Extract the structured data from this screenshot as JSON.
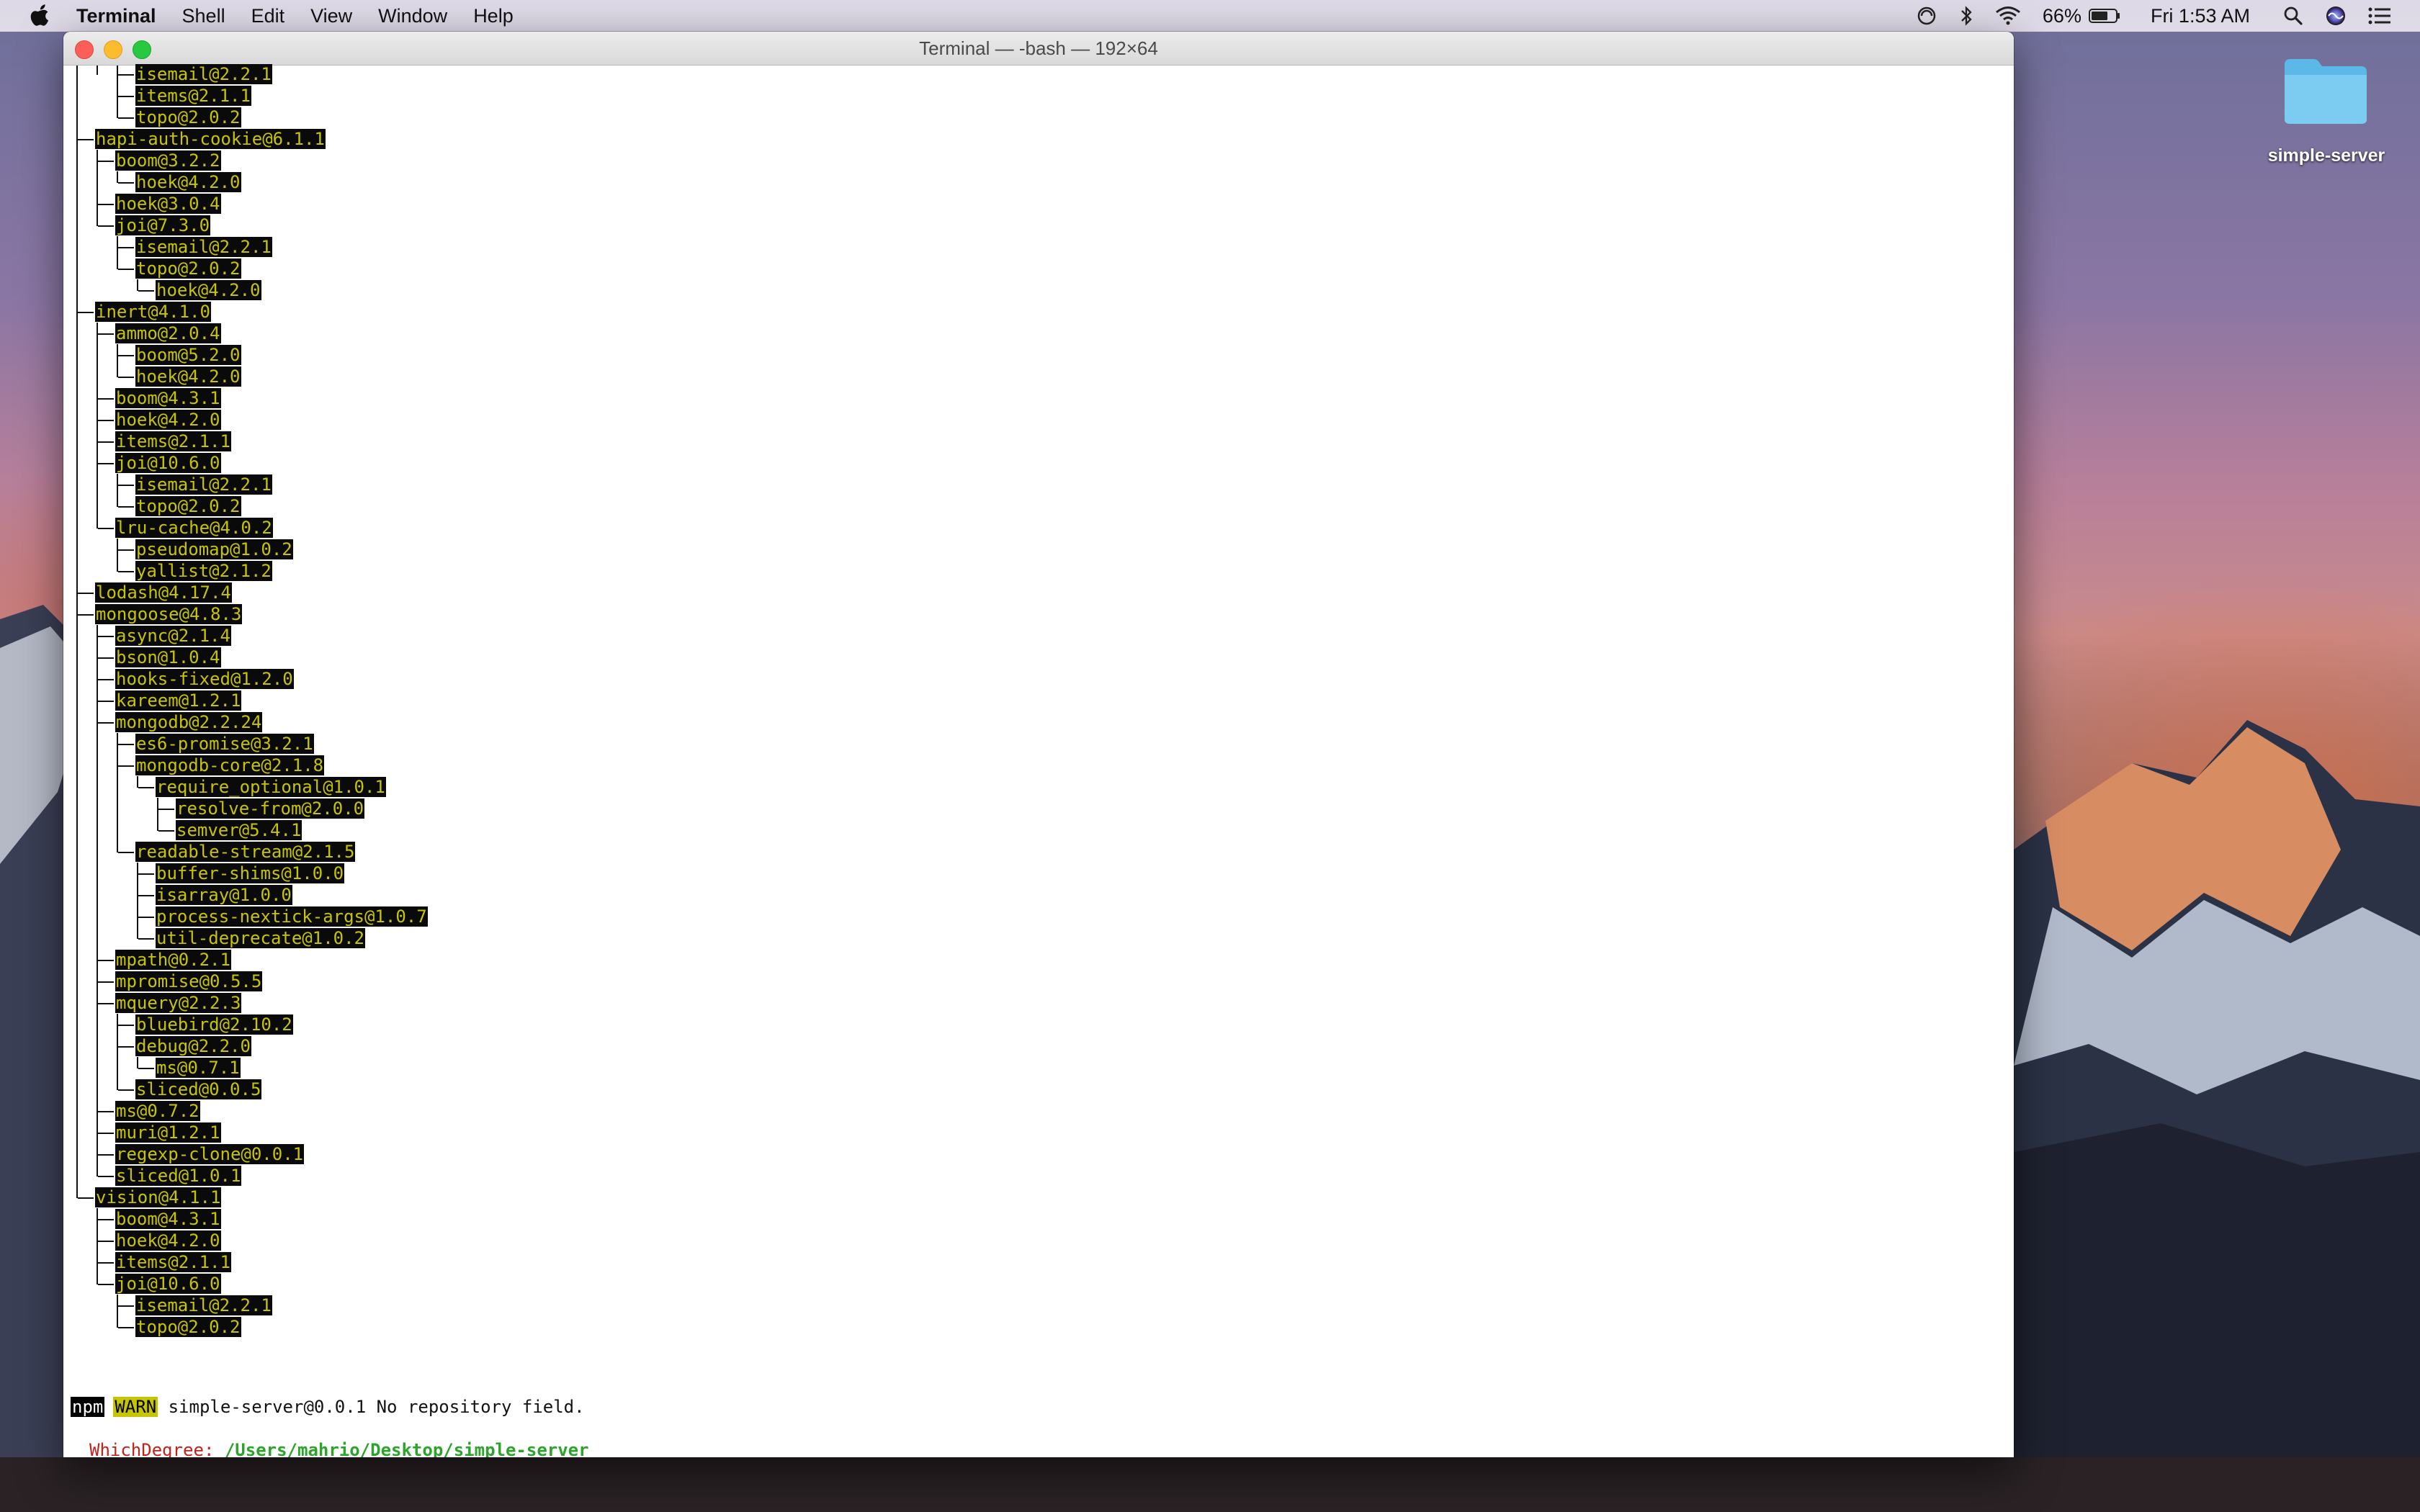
{
  "menubar": {
    "app_name": "Terminal",
    "menus": [
      "Shell",
      "Edit",
      "View",
      "Window",
      "Help"
    ],
    "battery": "66%",
    "clock": "Fri 1:53 AM"
  },
  "desktop": {
    "folder_label": "simple-server"
  },
  "window": {
    "title": "Terminal — -bash — 192×64"
  },
  "terminal": {
    "tree_lines": [
      {
        "depth": 3,
        "text": "isemail@2.2.1"
      },
      {
        "depth": 3,
        "text": "items@2.1.1"
      },
      {
        "depth": 3,
        "text": "topo@2.0.2"
      },
      {
        "depth": 1,
        "text": "hapi-auth-cookie@6.1.1"
      },
      {
        "depth": 2,
        "text": "boom@3.2.2"
      },
      {
        "depth": 3,
        "text": "hoek@4.2.0"
      },
      {
        "depth": 2,
        "text": "hoek@3.0.4"
      },
      {
        "depth": 2,
        "text": "joi@7.3.0"
      },
      {
        "depth": 3,
        "text": "isemail@2.2.1"
      },
      {
        "depth": 3,
        "text": "topo@2.0.2"
      },
      {
        "depth": 4,
        "text": "hoek@4.2.0"
      },
      {
        "depth": 1,
        "text": "inert@4.1.0"
      },
      {
        "depth": 2,
        "text": "ammo@2.0.4"
      },
      {
        "depth": 3,
        "text": "boom@5.2.0"
      },
      {
        "depth": 3,
        "text": "hoek@4.2.0"
      },
      {
        "depth": 2,
        "text": "boom@4.3.1"
      },
      {
        "depth": 2,
        "text": "hoek@4.2.0"
      },
      {
        "depth": 2,
        "text": "items@2.1.1"
      },
      {
        "depth": 2,
        "text": "joi@10.6.0"
      },
      {
        "depth": 3,
        "text": "isemail@2.2.1"
      },
      {
        "depth": 3,
        "text": "topo@2.0.2"
      },
      {
        "depth": 2,
        "text": "lru-cache@4.0.2"
      },
      {
        "depth": 3,
        "text": "pseudomap@1.0.2"
      },
      {
        "depth": 3,
        "text": "yallist@2.1.2"
      },
      {
        "depth": 1,
        "text": "lodash@4.17.4"
      },
      {
        "depth": 1,
        "text": "mongoose@4.8.3"
      },
      {
        "depth": 2,
        "text": "async@2.1.4"
      },
      {
        "depth": 2,
        "text": "bson@1.0.4"
      },
      {
        "depth": 2,
        "text": "hooks-fixed@1.2.0"
      },
      {
        "depth": 2,
        "text": "kareem@1.2.1"
      },
      {
        "depth": 2,
        "text": "mongodb@2.2.24"
      },
      {
        "depth": 3,
        "text": "es6-promise@3.2.1"
      },
      {
        "depth": 3,
        "text": "mongodb-core@2.1.8"
      },
      {
        "depth": 4,
        "text": "require_optional@1.0.1"
      },
      {
        "depth": 5,
        "text": "resolve-from@2.0.0"
      },
      {
        "depth": 5,
        "text": "semver@5.4.1"
      },
      {
        "depth": 3,
        "text": "readable-stream@2.1.5"
      },
      {
        "depth": 4,
        "text": "buffer-shims@1.0.0"
      },
      {
        "depth": 4,
        "text": "isarray@1.0.0"
      },
      {
        "depth": 4,
        "text": "process-nextick-args@1.0.7"
      },
      {
        "depth": 4,
        "text": "util-deprecate@1.0.2"
      },
      {
        "depth": 2,
        "text": "mpath@0.2.1"
      },
      {
        "depth": 2,
        "text": "mpromise@0.5.5"
      },
      {
        "depth": 2,
        "text": "mquery@2.2.3"
      },
      {
        "depth": 3,
        "text": "bluebird@2.10.2"
      },
      {
        "depth": 3,
        "text": "debug@2.2.0"
      },
      {
        "depth": 4,
        "text": "ms@0.7.1"
      },
      {
        "depth": 3,
        "text": "sliced@0.0.5"
      },
      {
        "depth": 2,
        "text": "ms@0.7.2"
      },
      {
        "depth": 2,
        "text": "muri@1.2.1"
      },
      {
        "depth": 2,
        "text": "regexp-clone@0.0.1"
      },
      {
        "depth": 2,
        "text": "sliced@1.0.1"
      },
      {
        "depth": 1,
        "text": "vision@4.1.1"
      },
      {
        "depth": 2,
        "text": "boom@4.3.1"
      },
      {
        "depth": 2,
        "text": "hoek@4.2.0"
      },
      {
        "depth": 2,
        "text": "items@2.1.1"
      },
      {
        "depth": 2,
        "text": "joi@10.6.0"
      },
      {
        "depth": 3,
        "text": "isemail@2.2.1"
      },
      {
        "depth": 3,
        "text": "topo@2.0.2"
      }
    ],
    "npm_tag": "npm",
    "warn_tag": "WARN",
    "warn_message": " simple-server@0.0.1 No repository field.",
    "prompt_label": "WhichDegree: ",
    "prompt_path": "/Users/mahrio/Desktop/simple-server",
    "prompt_symbol": "$:"
  }
}
